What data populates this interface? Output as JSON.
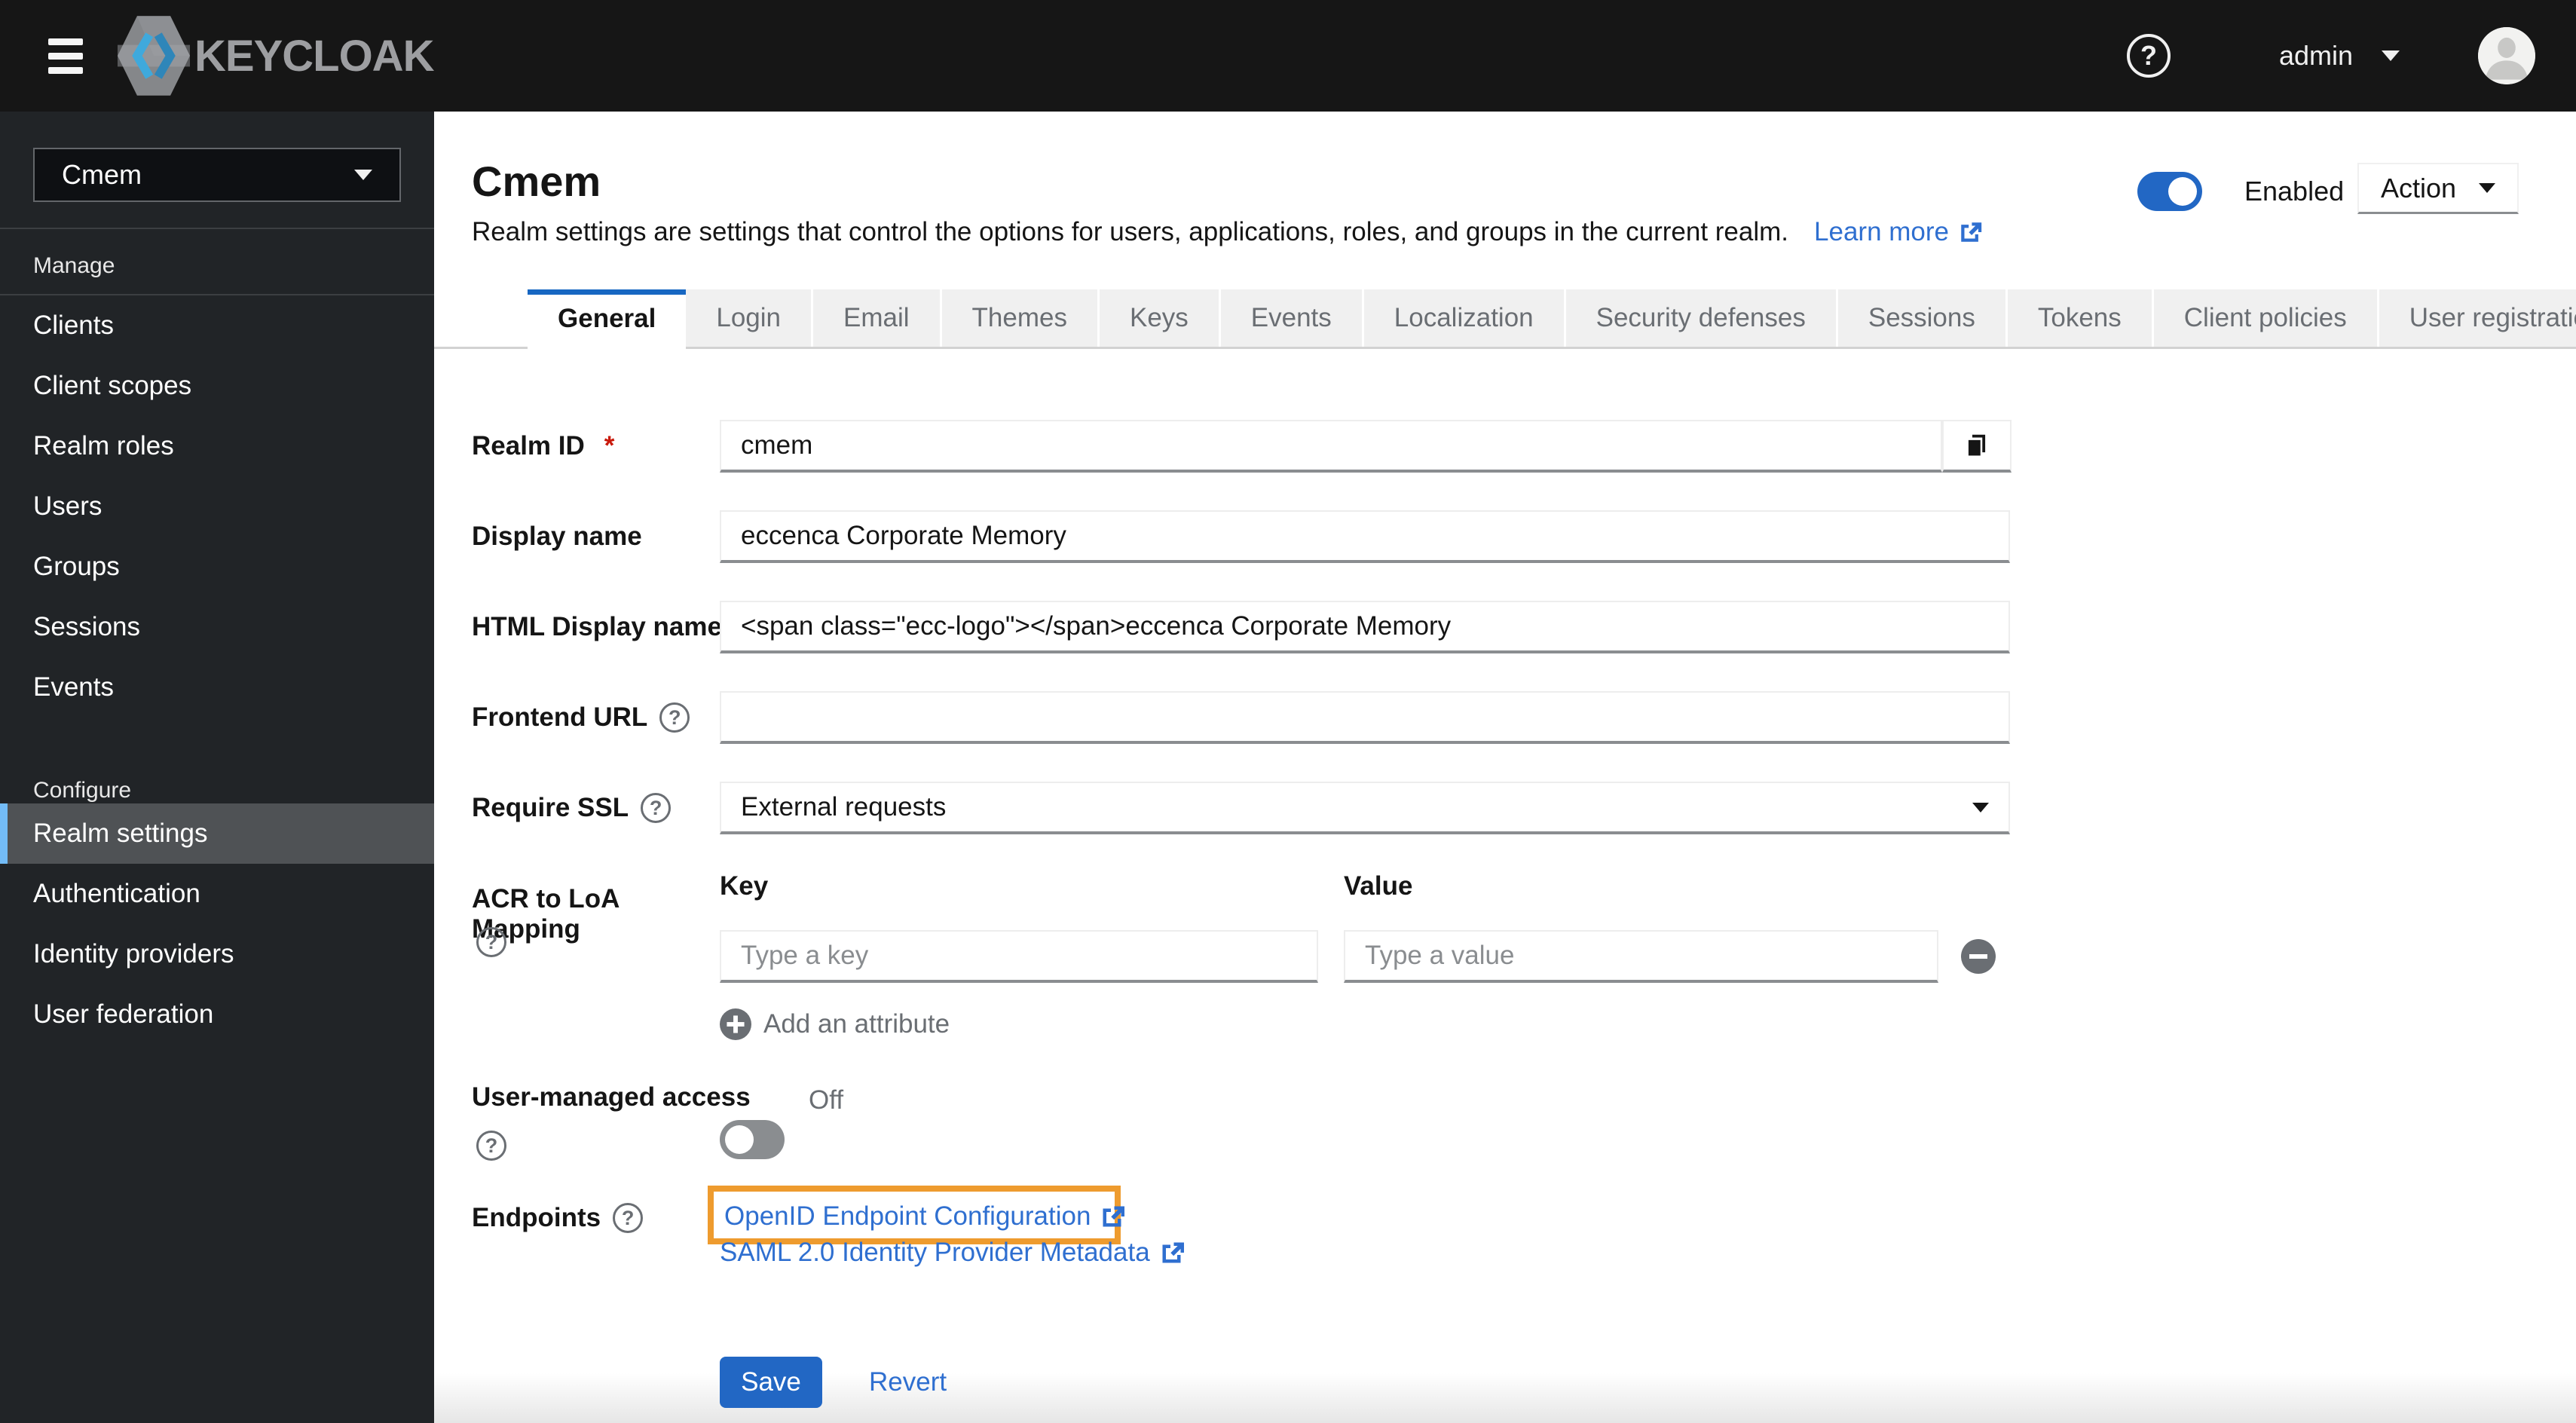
{
  "masthead": {
    "brand": "KEYCLOAK",
    "user": "admin"
  },
  "sidebar": {
    "realm": "Cmem",
    "manage_title": "Manage",
    "manage_items": [
      "Clients",
      "Client scopes",
      "Realm roles",
      "Users",
      "Groups",
      "Sessions",
      "Events"
    ],
    "configure_title": "Configure",
    "configure_items": [
      "Realm settings",
      "Authentication",
      "Identity providers",
      "User federation"
    ],
    "selected_item": "Realm settings"
  },
  "header": {
    "title": "Cmem",
    "description": "Realm settings are settings that control the options for users, applications, roles, and groups in the current realm.",
    "learn_more": "Learn more",
    "enabled_label": "Enabled",
    "enabled_state": "on",
    "action_label": "Action"
  },
  "tabs": {
    "active": "General",
    "items": [
      "General",
      "Login",
      "Email",
      "Themes",
      "Keys",
      "Events",
      "Localization",
      "Security defenses",
      "Sessions",
      "Tokens",
      "Client policies",
      "User registration"
    ]
  },
  "form": {
    "realm_id": {
      "label": "Realm ID",
      "required_marker": "*",
      "value": "cmem"
    },
    "display_name": {
      "label": "Display name",
      "value": "eccenca Corporate Memory"
    },
    "html_display_name": {
      "label": "HTML Display name",
      "value": "<span class=\"ecc-logo\"></span>eccenca Corporate Memory"
    },
    "frontend_url": {
      "label": "Frontend URL",
      "value": ""
    },
    "require_ssl": {
      "label": "Require SSL",
      "value": "External requests"
    },
    "acr": {
      "label": "ACR to LoA Mapping",
      "key_header": "Key",
      "value_header": "Value",
      "key_placeholder": "Type a key",
      "value_placeholder": "Type a value",
      "add_label": "Add an attribute"
    },
    "uma": {
      "label": "User-managed access",
      "state": "Off"
    },
    "endpoints": {
      "label": "Endpoints",
      "openid": "OpenID Endpoint Configuration",
      "saml": "SAML 2.0 Identity Provider Metadata"
    },
    "save": "Save",
    "revert": "Revert"
  },
  "colors": {
    "primary_blue": "#2267c4",
    "link_blue": "#2f6fd0",
    "highlight_orange": "#ee9b2e",
    "masthead_bg": "#161616",
    "sidebar_bg": "#212427",
    "selected_nav": "#4f5255",
    "selected_nav_border": "#73bcf7",
    "required_red": "#c9190b"
  }
}
